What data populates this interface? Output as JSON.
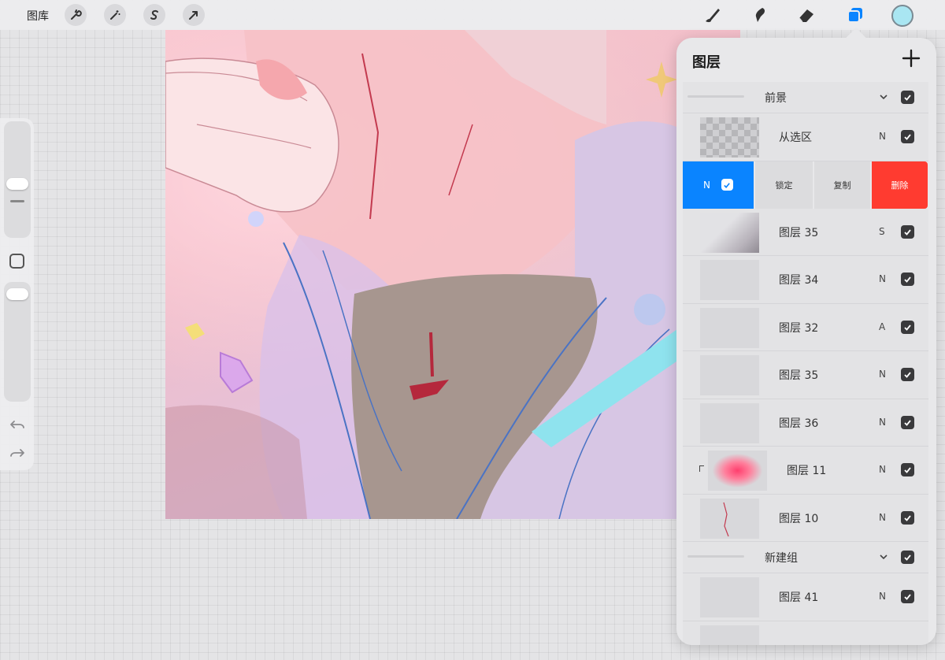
{
  "topbar": {
    "gallery_label": "图库",
    "left_tools": [
      "wrench-icon",
      "magic-wand-icon",
      "selection-s-icon",
      "transform-arrow-icon"
    ],
    "right_tools": [
      "brush-icon",
      "smudge-icon",
      "eraser-icon",
      "layers-icon"
    ],
    "active_tool": "layers-icon",
    "active_color": "#a9e6f2",
    "accent_color": "#0a84ff"
  },
  "sidebar": {
    "items": [
      "brush-size-slider",
      "square-modify-button",
      "opacity-slider",
      "undo-icon",
      "redo-icon"
    ]
  },
  "layers_panel": {
    "title": "图层",
    "add_icon": "plus-icon",
    "selected_actions": {
      "blend": "N",
      "lock_label": "锁定",
      "duplicate_label": "复制",
      "delete_label": "删除",
      "delete_color": "#ff3b30"
    },
    "rows": [
      {
        "kind": "group",
        "name": "前景",
        "visible": true
      },
      {
        "kind": "layer",
        "name": "从选区",
        "blend": "N",
        "visible": true,
        "thumb": "checker"
      },
      {
        "kind": "layer",
        "name": "图层 35",
        "blend": "S",
        "visible": true,
        "thumb": "grey-gradient"
      },
      {
        "kind": "layer",
        "name": "图层 34",
        "blend": "N",
        "visible": true,
        "thumb": "plain"
      },
      {
        "kind": "layer",
        "name": "图层 32",
        "blend": "A",
        "visible": true,
        "thumb": "plain"
      },
      {
        "kind": "layer",
        "name": "图层 35",
        "blend": "N",
        "visible": true,
        "thumb": "plain"
      },
      {
        "kind": "layer",
        "name": "图层 36",
        "blend": "N",
        "visible": true,
        "thumb": "plain"
      },
      {
        "kind": "layer",
        "name": "图层 11",
        "blend": "N",
        "visible": true,
        "thumb": "pink-blot",
        "clipped": true
      },
      {
        "kind": "layer",
        "name": "图层 10",
        "blend": "N",
        "visible": true,
        "thumb": "red-strokes"
      },
      {
        "kind": "group",
        "name": "新建组",
        "visible": true
      },
      {
        "kind": "layer",
        "name": "图层 41",
        "blend": "N",
        "visible": true,
        "thumb": "plain"
      }
    ]
  }
}
